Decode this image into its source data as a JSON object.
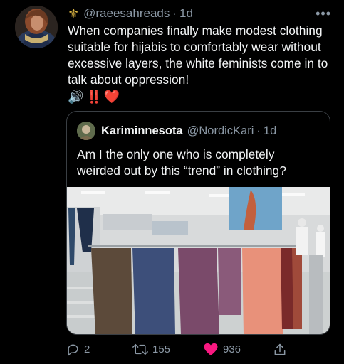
{
  "tweet": {
    "display_name": "",
    "handle": "@raeesahreads",
    "time": "1d",
    "body": "When companies finally make modest clothing suitable for hijabis to comfortably wear without excessive layers, the white feminists come in to talk about oppression!",
    "emoji": {
      "speaker": "🔊",
      "bang": "‼️",
      "heart": "❤️"
    },
    "more_label": "•••"
  },
  "quote": {
    "display_name": "Kariminnesota",
    "handle": "@NordicKari",
    "time": "1d",
    "body": "Am I the only one who is completely weirded out by this “trend” in clothing?"
  },
  "actions": {
    "replies": "2",
    "retweets": "155",
    "likes": "936"
  },
  "colors": {
    "background": "#000000",
    "text": "#e7e9ea",
    "muted": "#8b98a5",
    "like": "#f91880",
    "border": "#3a3f44"
  },
  "icons": [
    "fleur-de-lis-icon",
    "more-icon",
    "reply-icon",
    "retweet-icon",
    "heart-icon",
    "share-icon"
  ]
}
